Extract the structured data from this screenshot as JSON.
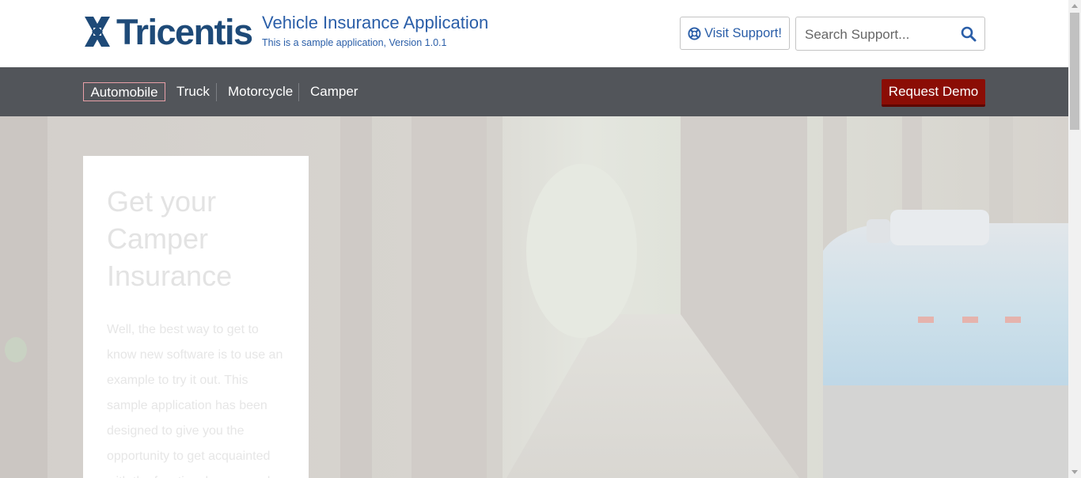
{
  "brand": {
    "logo_text": "Tricentis",
    "app_title": "Vehicle Insurance Application",
    "app_subtitle": "This is a sample application, Version 1.0.1"
  },
  "header": {
    "support_label": "Visit Support!",
    "search_placeholder": "Search Support..."
  },
  "nav": {
    "items": [
      {
        "label": "Automobile",
        "active": true
      },
      {
        "label": "Truck"
      },
      {
        "label": "Motorcycle"
      },
      {
        "label": "Camper"
      }
    ],
    "demo_label": "Request Demo"
  },
  "hero": {
    "title": "Get your Camper Insurance",
    "text": "Well, the best way to get to know new software is to use an example to try it out. This sample application has been designed to give you the opportunity to get acquainted with the functional scope and"
  },
  "colors": {
    "brand_blue": "#1e4a78",
    "link_blue": "#2a5ea8",
    "nav_bg": "#52555a",
    "demo_red": "#8b0d05"
  },
  "icons": [
    "tricentis-logo-icon",
    "lifebuoy-icon",
    "search-icon"
  ]
}
